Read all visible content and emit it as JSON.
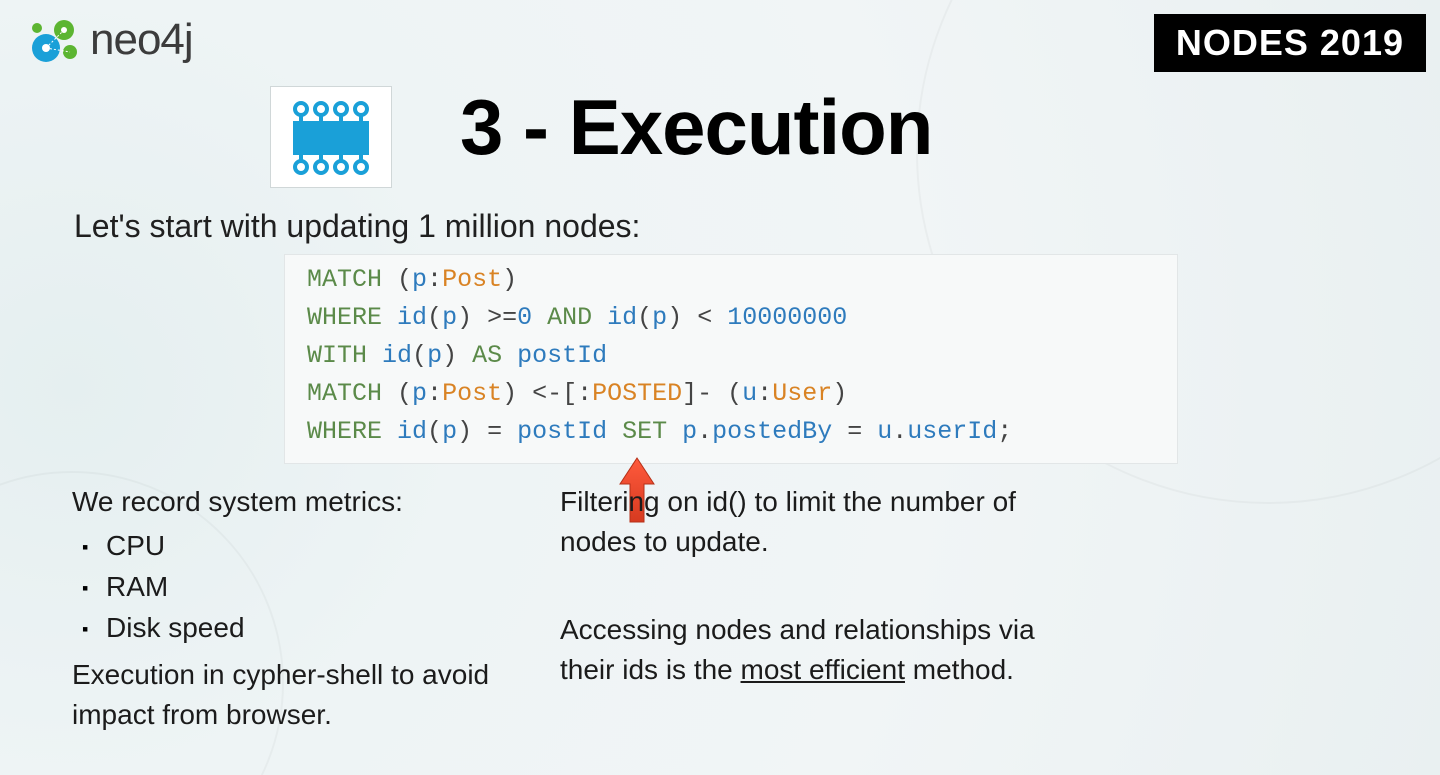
{
  "header": {
    "brand": "neo4j",
    "badge": "NODES 2019"
  },
  "slide": {
    "title": "3 - Execution",
    "intro": "Let's start with updating 1 million nodes:",
    "code": {
      "l1": {
        "kw1": "MATCH",
        "paren_open": " (",
        "v1": "p",
        "colon": ":",
        "lab": "Post",
        "paren_close": ")"
      },
      "l2": {
        "kw1": "WHERE",
        "sp": " ",
        "fn1": "id",
        "po": "(",
        "v1": "p",
        "pc": ")",
        "op1": " >=",
        "n1": "0",
        "kw2": " AND ",
        "fn2": "id",
        "po2": "(",
        "v2": "p",
        "pc2": ")",
        "op2": " < ",
        "n2": "10000000"
      },
      "l3": {
        "kw1": "WITH",
        "sp": " ",
        "fn1": "id",
        "po": "(",
        "v1": "p",
        "pc": ")",
        "kw2": " AS ",
        "alias": "postId"
      },
      "l4": {
        "kw1": "MATCH",
        "po": " (",
        "v1": "p",
        "colon": ":",
        "lab1": "Post",
        "pc": ")",
        "arr1": " <-[",
        "colon2": ":",
        "rel": "POSTED",
        "arr2": "]- (",
        "v2": "u",
        "colon3": ":",
        "lab2": "User",
        "pc2": ")"
      },
      "l5": {
        "kw1": "WHERE",
        "sp": " ",
        "fn1": "id",
        "po": "(",
        "v1": "p",
        "pc": ")",
        "eq": " = ",
        "alias": "postId",
        "kw2": " SET ",
        "v2": "p",
        "dot1": ".",
        "prop1": "postedBy",
        "eq2": " = ",
        "v3": "u",
        "dot2": ".",
        "prop2": "userId",
        "semi": ";"
      }
    },
    "left": {
      "lead": "We record system metrics:",
      "items": [
        "CPU",
        "RAM",
        "Disk speed"
      ],
      "footnote_a": "Execution in cypher-shell to avoid",
      "footnote_b": "impact from browser."
    },
    "right": {
      "p1a": "Filtering on id() to limit the number of",
      "p1b": "nodes to update.",
      "p2a": "Accessing nodes and relationships via",
      "p2b_pre": "their ids is the ",
      "p2b_underline": "most efficient",
      "p2b_post": " method."
    }
  }
}
